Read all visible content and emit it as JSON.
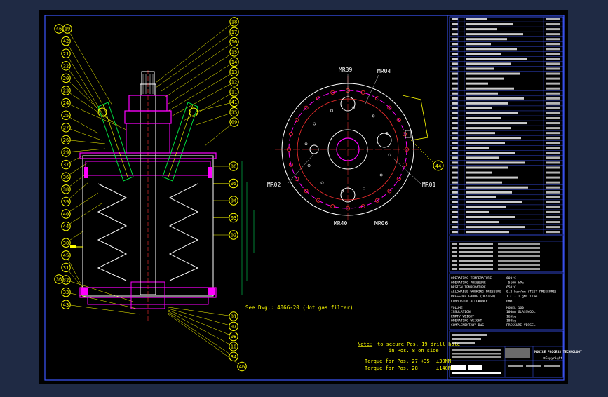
{
  "colors": {
    "background": "#1f2a44",
    "sheet": "#000000",
    "frame": "#3d57ff",
    "magenta": "#ff00ff",
    "yellow": "#ffff00",
    "white": "#ffffff",
    "red": "#ff3030",
    "cyan": "#00ffff",
    "green": "#00e040",
    "orange": "#ff8800"
  },
  "balloons_left": [
    "46",
    "19",
    "42",
    "21",
    "22",
    "20",
    "23",
    "24",
    "25",
    "27",
    "26",
    "29",
    "37",
    "36",
    "38",
    "39",
    "40",
    "44",
    "30",
    "45",
    "31",
    "32",
    "33",
    "43"
  ],
  "balloons_right_top": [
    "18",
    "17",
    "16",
    "15",
    "14",
    "13",
    "12",
    "11",
    "41",
    "35",
    "09"
  ],
  "balloons_right_mid": [
    "06",
    "05",
    "04",
    "03",
    "02"
  ],
  "balloons_right_bottom": [
    "01",
    "07",
    "08",
    "10",
    "34",
    "46"
  ],
  "top_view": {
    "labels": [
      "MR39",
      "MR04",
      "MR02",
      "MR01",
      "MR40",
      "MR06"
    ],
    "callout": "44"
  },
  "notes": {
    "see_dwg": "See Dwg.: 4066-20 (Hot gas filter)",
    "note_label": "Note:",
    "note_text_1": "to secure Pos. 19 drill hole",
    "note_text_2": "in Pos. 8 on side",
    "torque_1_label": "Torque for Pos. 27 +35",
    "torque_1_value": "±30NM",
    "torque_2_label": "Torque for Pos. 28",
    "torque_2_value": "±140NM"
  },
  "design_data": {
    "rows": [
      [
        "OPERATING TEMPERATURE",
        "600°C"
      ],
      [
        "OPERATING PRESSURE",
        "-5100 kPa"
      ],
      [
        "DESIGN TEMPERATURE",
        "650°C"
      ],
      [
        "ALLOWABLE WORKING PRESSURE",
        "0.2 bar/mm (TEST PRESSURE)"
      ],
      [
        "PRESSURE GROUP (DESIGN)",
        "I C - 1 gMa 1/mm"
      ],
      [
        "CORROSION ALLOWANCE",
        "0mm"
      ]
    ],
    "rows2": [
      [
        "VOLUME",
        "MODEL 160"
      ],
      [
        "INSULATION",
        "100mm GLASSWOOL"
      ],
      [
        "EMPTY WEIGHT",
        "165kg"
      ],
      [
        "OPERATING WEIGHT",
        "180kg"
      ],
      [
        "COMPLEMENTARY DWG",
        "PRESSURE VESSEL"
      ]
    ]
  },
  "title_block": {
    "company": "MOBILE PROCESS TECHNOLOGY",
    "copyright": "©Copyright"
  }
}
